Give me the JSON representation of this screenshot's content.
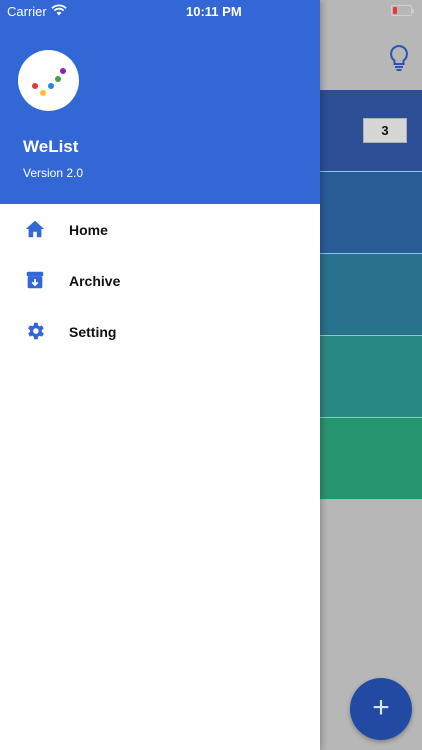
{
  "status_bar": {
    "carrier": "Carrier",
    "time": "10:11 PM"
  },
  "drawer": {
    "app_name": "WeList",
    "version": "Version 2.0",
    "menu": [
      {
        "label": "Home",
        "icon": "home-icon"
      },
      {
        "label": "Archive",
        "icon": "archive-icon"
      },
      {
        "label": "Setting",
        "icon": "gear-icon"
      }
    ]
  },
  "background": {
    "header_icon": "lightbulb-icon",
    "list_bands": [
      "#2c4f96",
      "#2a5c96",
      "#29718c",
      "#288a82",
      "#27956f"
    ],
    "count_badge": "3",
    "fab_icon": "+"
  },
  "colors": {
    "primary": "#3367d6",
    "fab": "#234aa3",
    "scrim": "#b7b7b7"
  }
}
